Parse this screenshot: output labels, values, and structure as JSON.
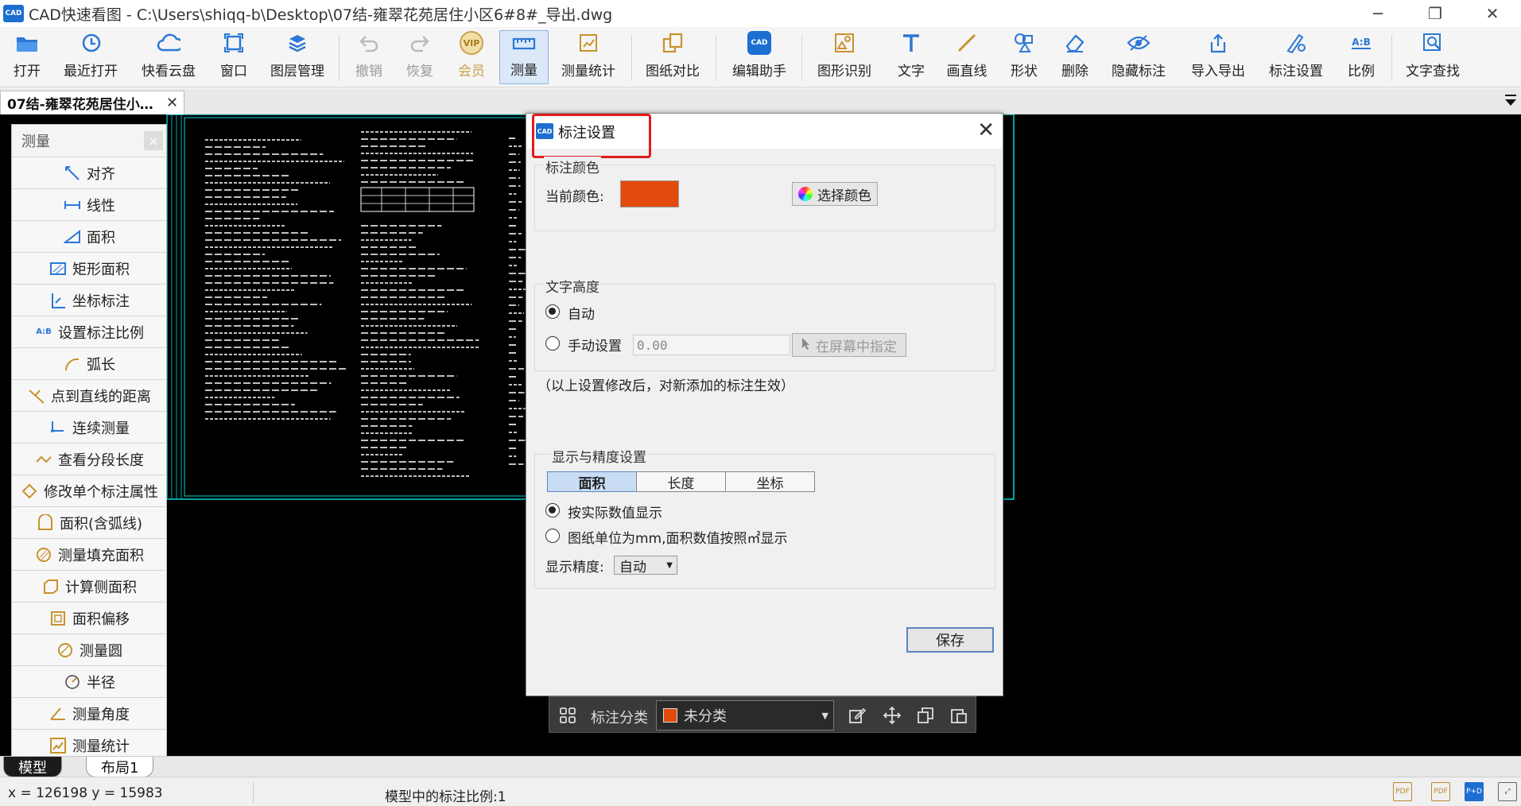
{
  "window": {
    "logo_text": "CAD",
    "title": "CAD快速看图 - C:\\Users\\shiqq-b\\Desktop\\07结-雍翠花苑居住小区6#8#_导出.dwg"
  },
  "toolbar": {
    "open": "打开",
    "recent": "最近打开",
    "cloud": "快看云盘",
    "window": "窗口",
    "layers": "图层管理",
    "undo": "撤销",
    "redo": "恢复",
    "vip": "会员",
    "vip_badge": "VIP",
    "measure": "测量",
    "measure_stats": "测量统计",
    "compare": "图纸对比",
    "edit_helper": "编辑助手",
    "edit_helper_badge": "CAD",
    "shape_recog": "图形识别",
    "text": "文字",
    "line": "画直线",
    "shape": "形状",
    "delete": "删除",
    "hide_annot": "隐藏标注",
    "import_export": "导入导出",
    "annot_settings": "标注设置",
    "scale": "比例",
    "scale_icon": "A:B",
    "text_search": "文字查找"
  },
  "doc_tab": {
    "title": "07结-雍翠花苑居住小…",
    "close": "✕"
  },
  "measure_panel": {
    "title": "测量",
    "close": "×",
    "items": [
      "对齐",
      "线性",
      "面积",
      "矩形面积",
      "坐标标注",
      "设置标注比例",
      "弧长",
      "点到直线的距离",
      "连续测量",
      "查看分段长度",
      "修改单个标注属性",
      "面积(含弧线)",
      "测量填充面积",
      "计算侧面积",
      "面积偏移",
      "测量圆",
      "半径",
      "测量角度",
      "测量统计"
    ]
  },
  "dialog": {
    "logo_text": "CAD",
    "title": "标注设置",
    "close": "✕",
    "color_group": "标注颜色",
    "current_color_label": "当前颜色:",
    "current_color": "#e24b0c",
    "choose_color": "选择颜色",
    "text_height_group": "文字高度",
    "auto": "自动",
    "manual": "手动设置",
    "manual_value": "0.00",
    "pick_on_screen": "在屏幕中指定",
    "note": "（以上设置修改后，对新添加的标注生效）",
    "display_group": "显示与精度设置",
    "tabs": [
      "面积",
      "长度",
      "坐标"
    ],
    "opt_actual": "按实际数值显示",
    "opt_mm": "图纸单位为mm,面积数值按照㎡显示",
    "precision_label": "显示精度:",
    "precision_value": "自动",
    "save": "保存"
  },
  "float_bar": {
    "category_label": "标注分类",
    "category_value": "未分类",
    "category_color": "#e24b0c"
  },
  "layout_tabs": [
    "模型",
    "布局1"
  ],
  "status": {
    "coords": "x = 126198  y = 15983",
    "scale": "模型中的标注比例:1"
  },
  "colors": {
    "accent": "#1c6fd1",
    "canvas": "#000000",
    "cad_lines": "#00d5d5",
    "highlight_box": "#e21b1b"
  }
}
